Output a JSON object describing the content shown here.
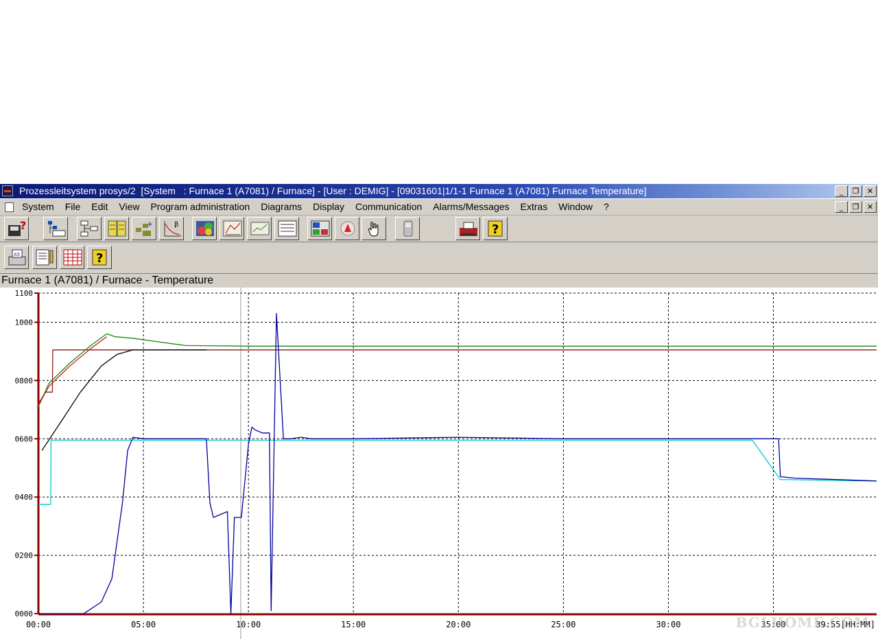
{
  "window": {
    "title": "Prozessleitsystem prosys/2  [System   : Furnace 1 (A7081) / Furnace] - [User : DEMIG] - [09031601|1/1-1 Furnace 1 (A7081) Furnace Temperature]",
    "minimize": "_",
    "restore": "❐",
    "close": "✕"
  },
  "menu": {
    "items": [
      "System",
      "File",
      "Edit",
      "View",
      "Program administration",
      "Diagrams",
      "Display",
      "Communication",
      "Alarms/Messages",
      "Extras",
      "Window",
      "?"
    ]
  },
  "toolbar1": {
    "buttons": [
      "save-help-icon",
      "tree-list-icon",
      "flowchart-icon",
      "program-list-icon",
      "program-add-icon",
      "curve-beta-icon",
      "color-palette-icon",
      "xy-plot-icon",
      "trend-icon",
      "report-icon",
      "layout-icon",
      "alarm-icon",
      "hand-pointer-icon",
      "handheld-icon",
      "printer-alarm-icon",
      "help-book-icon"
    ]
  },
  "toolbar2": {
    "buttons": [
      "print-a5-icon",
      "document-edit-icon",
      "grid-table-icon",
      "help-book-icon"
    ]
  },
  "chart_title": "Furnace 1 (A7081) / Furnace - Temperature",
  "watermark": "BGLHOME.COM",
  "colors": {
    "background": "#ffffff",
    "axis": "#8b0000",
    "grid": "#000000",
    "series_actual": "#0000a0",
    "series_setpoint_low": "#00c8c8",
    "series_setpoint_high": "#8b1a1a",
    "series_green": "#138a13",
    "series_black": "#000000"
  },
  "chart_data": {
    "type": "line",
    "title": "Furnace 1 (A7081) / Furnace - Temperature",
    "xlabel": "",
    "ylabel": "",
    "x_unit": "[HH:MM]",
    "xlim": [
      "00:00",
      "39:55"
    ],
    "ylim": [
      0,
      1100
    ],
    "y_ticks": [
      "0000",
      "0200",
      "0400",
      "0600",
      "0800",
      "1000",
      "1100"
    ],
    "x_ticks": [
      "00:00",
      "05:00",
      "10:00",
      "15:00",
      "20:00",
      "25:00",
      "30:00",
      "35:00",
      "39:55[HH:MM]"
    ],
    "grid": true,
    "legend": "none",
    "series": [
      {
        "color": "#0000a0",
        "x": [
          "00:00",
          "01:50",
          "02:10",
          "03:00",
          "03:30",
          "04:00",
          "04:15",
          "04:30",
          "05:00",
          "06:00",
          "07:00",
          "08:00",
          "08:10",
          "08:20",
          "09:00",
          "09:10",
          "09:20",
          "09:40",
          "10:00",
          "10:10",
          "10:20",
          "10:40",
          "11:00",
          "11:05",
          "11:20",
          "11:40",
          "12:00",
          "12:30",
          "13:00",
          "15:00",
          "20:00",
          "25:00",
          "30:00",
          "34:00",
          "35:15",
          "35:20",
          "36:00",
          "38:00",
          "39:55"
        ],
        "y": [
          0,
          0,
          0,
          40,
          120,
          380,
          560,
          605,
          600,
          600,
          600,
          600,
          380,
          330,
          350,
          0,
          330,
          330,
          580,
          640,
          630,
          620,
          620,
          10,
          1030,
          600,
          600,
          605,
          600,
          600,
          605,
          600,
          600,
          600,
          600,
          470,
          465,
          460,
          455
        ]
      },
      {
        "color": "#00c8c8",
        "x": [
          "00:00",
          "00:35",
          "00:36",
          "10:00",
          "34:00",
          "35:20",
          "39:55"
        ],
        "y": [
          375,
          375,
          595,
          595,
          595,
          460,
          455
        ]
      },
      {
        "color": "#8b1a1a",
        "x": [
          "00:00",
          "00:20",
          "00:40",
          "00:41",
          "39:55"
        ],
        "y": [
          720,
          760,
          760,
          905,
          905
        ]
      },
      {
        "color": "#138a13",
        "x": [
          "00:00",
          "00:30",
          "01:30",
          "02:30",
          "03:15",
          "03:40",
          "04:30",
          "05:30",
          "07:00",
          "10:00",
          "15:00",
          "39:55"
        ],
        "y": [
          710,
          790,
          860,
          920,
          960,
          950,
          945,
          935,
          920,
          918,
          918,
          918
        ]
      },
      {
        "color": "#cc2020",
        "x": [
          "00:00",
          "00:30",
          "01:30",
          "02:30",
          "03:15"
        ],
        "y": [
          715,
          780,
          850,
          910,
          950
        ]
      },
      {
        "color": "#000000",
        "x": [
          "00:10",
          "01:00",
          "02:00",
          "03:00",
          "03:45",
          "04:30",
          "08:00"
        ],
        "y": [
          560,
          650,
          760,
          850,
          890,
          905,
          905
        ]
      }
    ]
  }
}
